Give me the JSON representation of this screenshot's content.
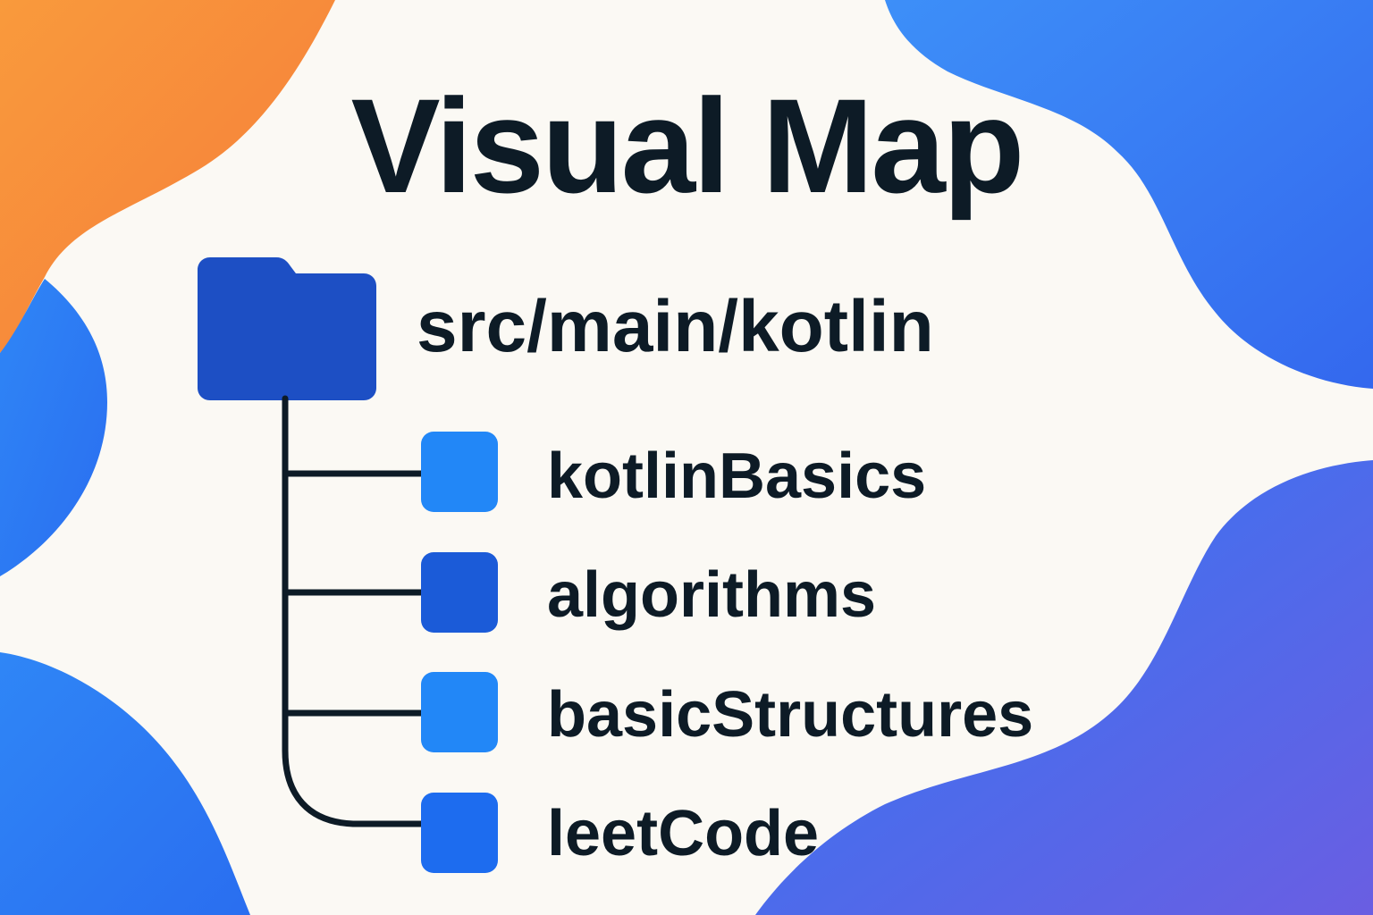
{
  "title": "Visual Map",
  "root": {
    "label": "src/main/kotlin",
    "icon": "folder-icon",
    "color": "#1d4fc4"
  },
  "children": [
    {
      "label": "kotlinBasics",
      "color": "#2287f7"
    },
    {
      "label": "algorithms",
      "color": "#1b5bd8"
    },
    {
      "label": "basicStructures",
      "color": "#2287f7"
    },
    {
      "label": "leetCode",
      "color": "#1d6cef"
    }
  ],
  "colors": {
    "background": "#fbf9f4",
    "text": "#0d1b26",
    "line": "#0d1b26",
    "blob_orange": "#f98a3a",
    "blob_blue": "#2f7df6",
    "blob_purple": "#6b5fe0"
  }
}
